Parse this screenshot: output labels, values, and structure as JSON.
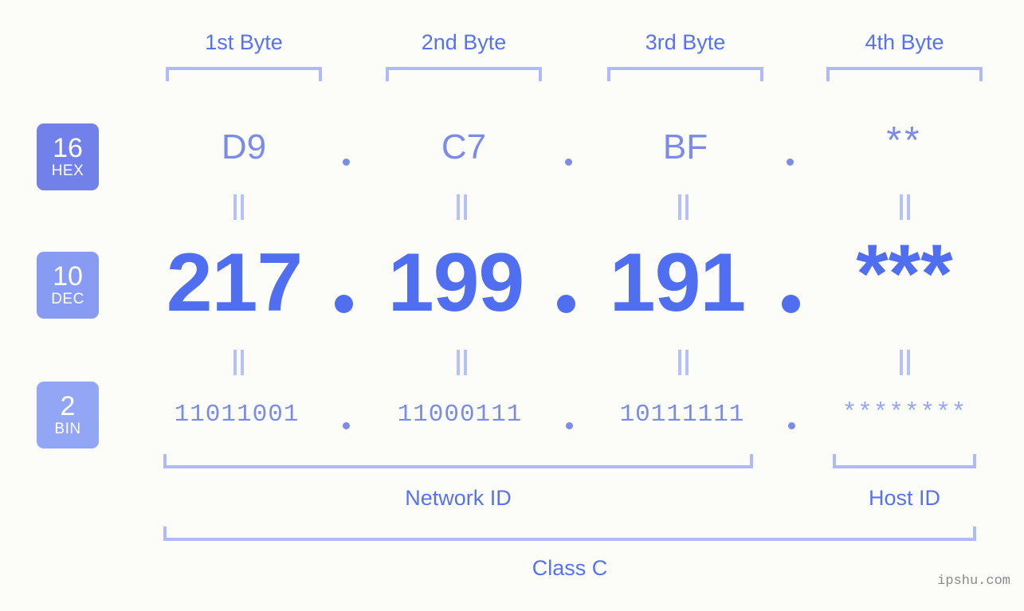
{
  "page": {
    "background": "#fcfdf8",
    "accent_primary": "#4f6ef0",
    "accent_secondary": "#7b8ce8",
    "accent_light": "#aebafc",
    "watermark": "ipshu.com"
  },
  "byte_headers": [
    {
      "label": "1st Byte"
    },
    {
      "label": "2nd Byte"
    },
    {
      "label": "3rd Byte"
    },
    {
      "label": "4th Byte"
    }
  ],
  "radix_badges": [
    {
      "number": "16",
      "name": "HEX",
      "color": "#7280ea"
    },
    {
      "number": "10",
      "name": "DEC",
      "color": "#879bf3"
    },
    {
      "number": "2",
      "name": "BIN",
      "color": "#93a5f5"
    }
  ],
  "rows": {
    "hex": {
      "radix": "16",
      "radix_name": "HEX",
      "values": [
        "D9",
        "C7",
        "BF",
        "**"
      ],
      "separator": "."
    },
    "dec": {
      "radix": "10",
      "radix_name": "DEC",
      "values": [
        "217",
        "199",
        "191",
        "***"
      ],
      "separator": "."
    },
    "bin": {
      "radix": "2",
      "radix_name": "BIN",
      "values": [
        "11011001",
        "11000111",
        "10111111",
        "********"
      ],
      "separator": "."
    }
  },
  "equality_separator": "=",
  "footer": {
    "network_id": "Network ID",
    "host_id": "Host ID",
    "class": "Class C"
  }
}
